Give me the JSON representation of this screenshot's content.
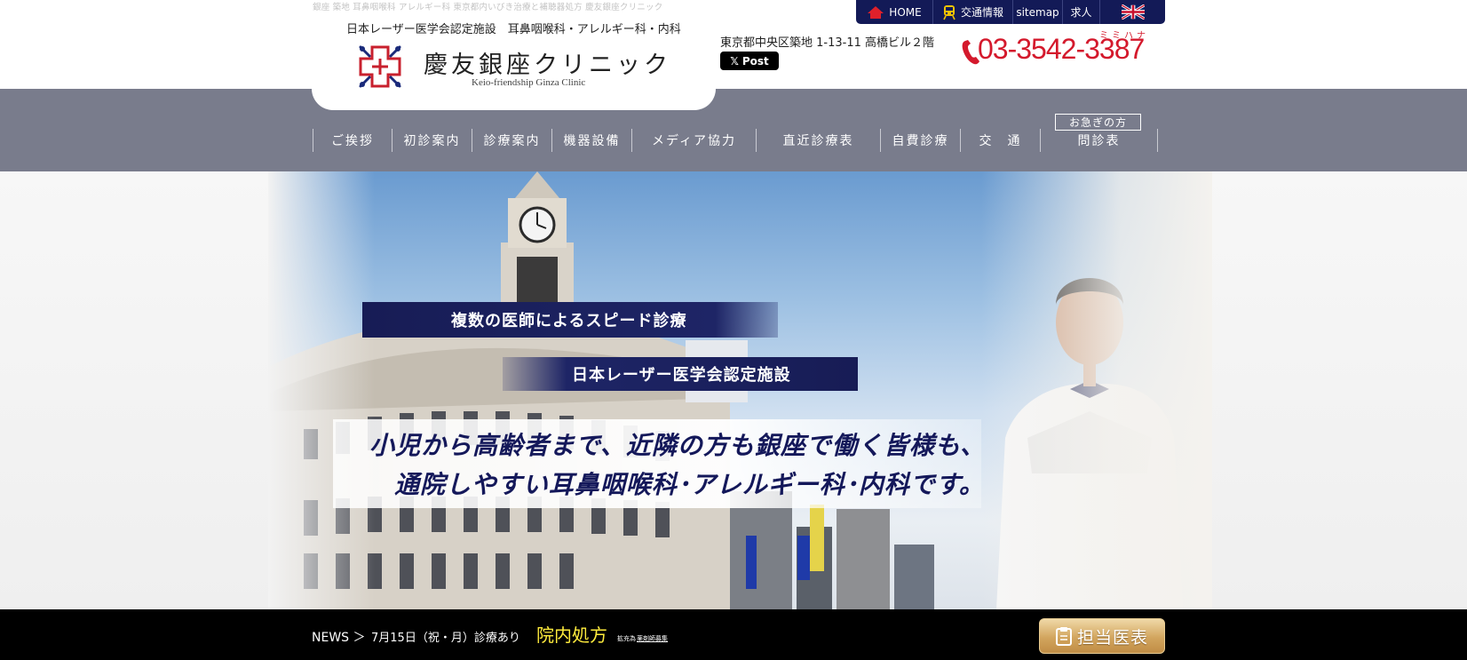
{
  "header": {
    "seo_text": "銀座 築地 耳鼻咽喉科 アレルギー科 東京都内いびき治療と補聴器処方 慶友銀座クリニック",
    "tagline": "日本レーザー医学会認定施設　耳鼻咽喉科・アレルギー科・内科",
    "clinic_name": "慶友銀座クリニック",
    "clinic_name_en": "Keio-friendship Ginza Clinic",
    "address": "東京都中央区築地 1-13-11 高橋ビル２階",
    "x_post_label": "Post",
    "phone": "03-3542-3387",
    "phone_ruby": "ミミハナ"
  },
  "topnav": {
    "home": "HOME",
    "access": "交通情報",
    "sitemap": "sitemap",
    "jobs": "求人"
  },
  "mainnav": {
    "urgent_label": "お急ぎの方",
    "items": [
      "ご挨拶",
      "初診案内",
      "診療案内",
      "機器設備",
      "メディア協力",
      "直近診療表",
      "自費診療",
      "交　通",
      "問診表"
    ]
  },
  "hero": {
    "banner1": "複数の医師によるスピード診療",
    "banner2": "日本レーザー医学会認定施設",
    "lead_line1": "小児から高齢者まで、近隣の方も銀座で働く皆様も、",
    "lead_line2": "通院しやすい耳鼻咽喉科･アレルギー科･内科です。"
  },
  "news": {
    "label": "NEWS ＞",
    "text": "7月15日（祝・月）診療あり",
    "highlight": "院内処方",
    "small1": "拡充為",
    "small2": "薬剤師募集"
  },
  "doctor_button": "担当医表",
  "colors": {
    "navy": "#131a57",
    "nav_gray": "#797c8c",
    "phone_red": "#d4192c",
    "news_yellow": "#ffec3d",
    "gold": "#c08d45"
  }
}
